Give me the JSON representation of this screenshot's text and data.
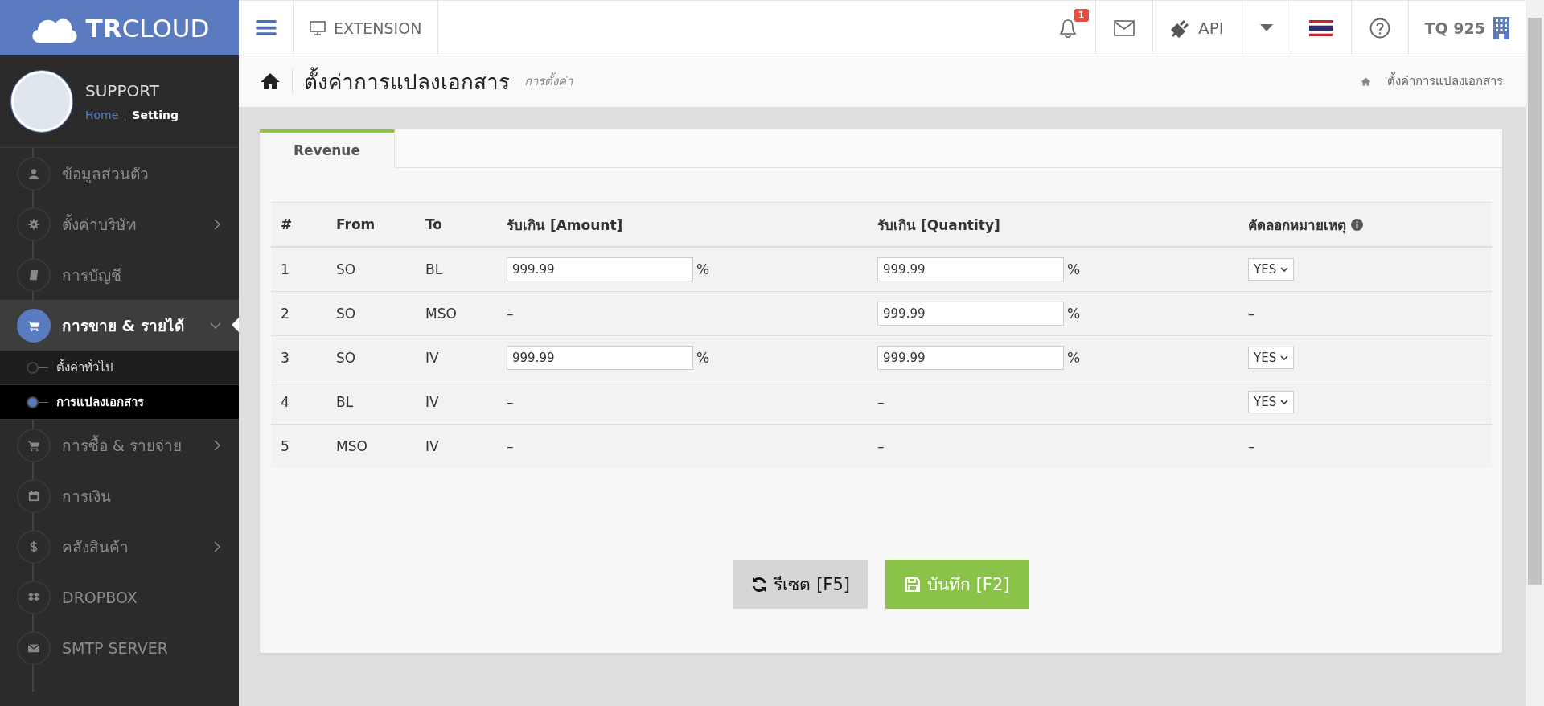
{
  "logo": {
    "text": "**TR**CLOUD"
  },
  "topbar": {
    "extension": "EXTENSION",
    "notification_count": "1",
    "api": "API",
    "user": "TQ 925"
  },
  "profile": {
    "name": "SUPPORT",
    "links": [
      {
        "label": "Home",
        "selected": false
      },
      {
        "label": "Setting",
        "selected": true
      }
    ]
  },
  "sidebar": {
    "items": [
      {
        "label": "ข้อมูลส่วนตัว",
        "selected": false
      },
      {
        "label": "ตั้งค่าบริษัท",
        "selected": false,
        "expanded": false
      },
      {
        "label": "การบัญชี",
        "selected": false
      },
      {
        "label": "การขาย & รายได้",
        "selected": true,
        "expanded": true,
        "children": [
          {
            "label": "ตั้งค่าทั่วไป",
            "selected": false
          },
          {
            "label": "การแปลงเอกสาร",
            "selected": true
          }
        ]
      },
      {
        "label": "การซื้อ & รายจ่าย",
        "selected": false,
        "expanded": false
      },
      {
        "label": "การเงิน",
        "selected": false
      },
      {
        "label": "คลังสินค้า",
        "selected": false,
        "expanded": false
      },
      {
        "label": "DROPBOX",
        "selected": false
      },
      {
        "label": "SMTP SERVER",
        "selected": false
      }
    ]
  },
  "page": {
    "title": "ตั้งค่าการแปลงเอกสาร",
    "subtitle": "การตั้งค่า",
    "breadcrumb": "ตั้งค่าการแปลงเอกสาร"
  },
  "tabs": [
    {
      "label": "Revenue",
      "selected": true
    }
  ],
  "table": {
    "columns": [
      "#",
      "From",
      "To",
      "รับเกิน [Amount]",
      "รับเกิน [Quantity]",
      "คัดลอกหมายเหตุ"
    ],
    "rows": [
      {
        "no": "1",
        "from": "SO",
        "to": "BL",
        "amount": {
          "kind": "input",
          "value": "999.99",
          "unit": "%"
        },
        "quantity": {
          "kind": "input",
          "value": "999.99",
          "unit": "%"
        },
        "remark": {
          "kind": "select",
          "value": "YES"
        }
      },
      {
        "no": "2",
        "from": "SO",
        "to": "MSO",
        "amount": {
          "kind": "text",
          "value": "–"
        },
        "quantity": {
          "kind": "input",
          "value": "999.99",
          "unit": "%"
        },
        "remark": {
          "kind": "text",
          "value": "–"
        }
      },
      {
        "no": "3",
        "from": "SO",
        "to": "IV",
        "amount": {
          "kind": "input",
          "value": "999.99",
          "unit": "%"
        },
        "quantity": {
          "kind": "input",
          "value": "999.99",
          "unit": "%"
        },
        "remark": {
          "kind": "select",
          "value": "YES"
        }
      },
      {
        "no": "4",
        "from": "BL",
        "to": "IV",
        "amount": {
          "kind": "text",
          "value": "–"
        },
        "quantity": {
          "kind": "text",
          "value": "–"
        },
        "remark": {
          "kind": "select",
          "value": "YES"
        }
      },
      {
        "no": "5",
        "from": "MSO",
        "to": "IV",
        "amount": {
          "kind": "text",
          "value": "–"
        },
        "quantity": {
          "kind": "text",
          "value": "–"
        },
        "remark": {
          "kind": "text",
          "value": "–"
        }
      }
    ]
  },
  "buttons": [
    {
      "kind": "reset",
      "label": "รีเซต [F5]"
    },
    {
      "kind": "save",
      "label": "บันทึก [F2]"
    }
  ]
}
